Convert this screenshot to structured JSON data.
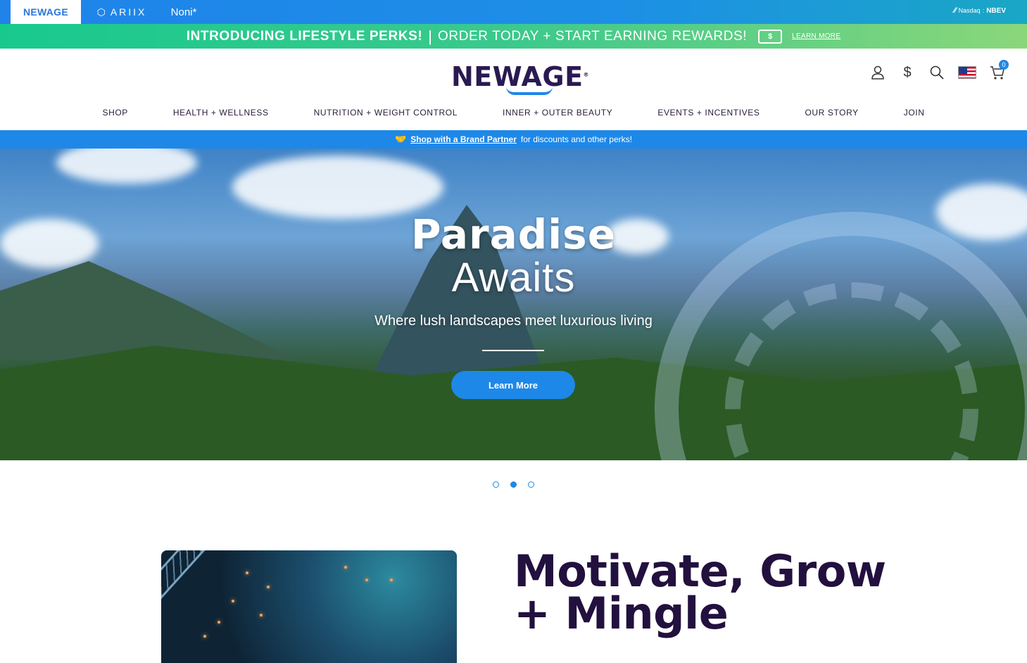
{
  "brandbar": {
    "tabs": [
      {
        "label": "NEWAGE",
        "active": true
      },
      {
        "label": "ARIIX",
        "active": false
      },
      {
        "label": "Noni",
        "active": false
      }
    ],
    "nasdaq_label": "Nasdaq",
    "ticker": "NBEV"
  },
  "promo": {
    "headline": "INTRODUCING LIFESTYLE PERKS!",
    "separator": "|",
    "message": "ORDER TODAY + START EARNING REWARDS!",
    "link": "LEARN MORE"
  },
  "header": {
    "logo_text": "NEWAGE",
    "cart_count": "0",
    "icons": [
      "user-icon",
      "currency-icon",
      "search-icon",
      "us-flag-icon",
      "cart-icon"
    ]
  },
  "nav": {
    "items": [
      "SHOP",
      "HEALTH + WELLNESS",
      "NUTRITION + WEIGHT CONTROL",
      "INNER + OUTER BEAUTY",
      "EVENTS + INCENTIVES",
      "OUR STORY",
      "JOIN"
    ]
  },
  "partner_bar": {
    "link": "Shop with a Brand Partner",
    "text": "for discounts and other perks!"
  },
  "hero": {
    "title": "Paradise",
    "subtitle": "Awaits",
    "tagline": "Where lush landscapes meet luxurious living",
    "button": "Learn More",
    "slide_count": 3,
    "active_slide": 2
  },
  "section": {
    "title_line1": "Motivate, Grow",
    "title_line2": "+ Mingle"
  },
  "colors": {
    "brand_blue": "#1e88e8",
    "brand_purple": "#22103e",
    "promo_green": "#18c98e"
  }
}
